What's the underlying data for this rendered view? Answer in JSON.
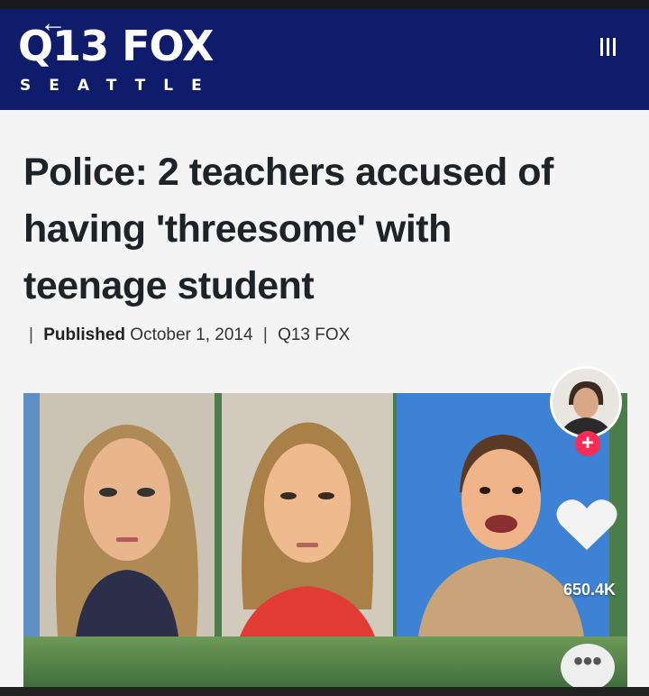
{
  "header": {
    "back_arrow": "←",
    "logo_main": "Q13 FOX",
    "logo_sub": "SEATTLE",
    "brand_color": "#0f1c6b"
  },
  "article": {
    "headline": "Police: 2 teachers accused of having 'threesome' with teenage student",
    "published_label": "Published",
    "published_date": "October 1, 2014",
    "source": "Q13 FOX"
  },
  "photos": [
    {
      "name": "mugshot-woman-1"
    },
    {
      "name": "mugshot-woman-2"
    },
    {
      "name": "school-portrait-teen"
    }
  ],
  "actions": {
    "follow_symbol": "+",
    "like_count": "650.4K",
    "more_symbol": "•••",
    "accent_color": "#fe2c55"
  }
}
